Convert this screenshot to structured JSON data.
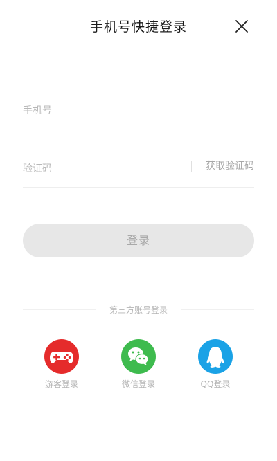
{
  "header": {
    "title": "手机号快捷登录"
  },
  "form": {
    "phone_placeholder": "手机号",
    "code_placeholder": "验证码",
    "get_code_label": "获取验证码",
    "login_label": "登录"
  },
  "third_party": {
    "title": "第三方账号登录",
    "options": [
      {
        "label": "游客登录",
        "icon": "gamepad-icon",
        "color": "#e52b2b"
      },
      {
        "label": "微信登录",
        "icon": "wechat-icon",
        "color": "#3ebb4e"
      },
      {
        "label": "QQ登录",
        "icon": "qq-penguin-icon",
        "color": "#1aa2e6"
      }
    ]
  },
  "colors": {
    "login_button_bg": "#e7e7e7",
    "login_button_text": "#a9a9a9",
    "placeholder": "#b8b8b8"
  }
}
